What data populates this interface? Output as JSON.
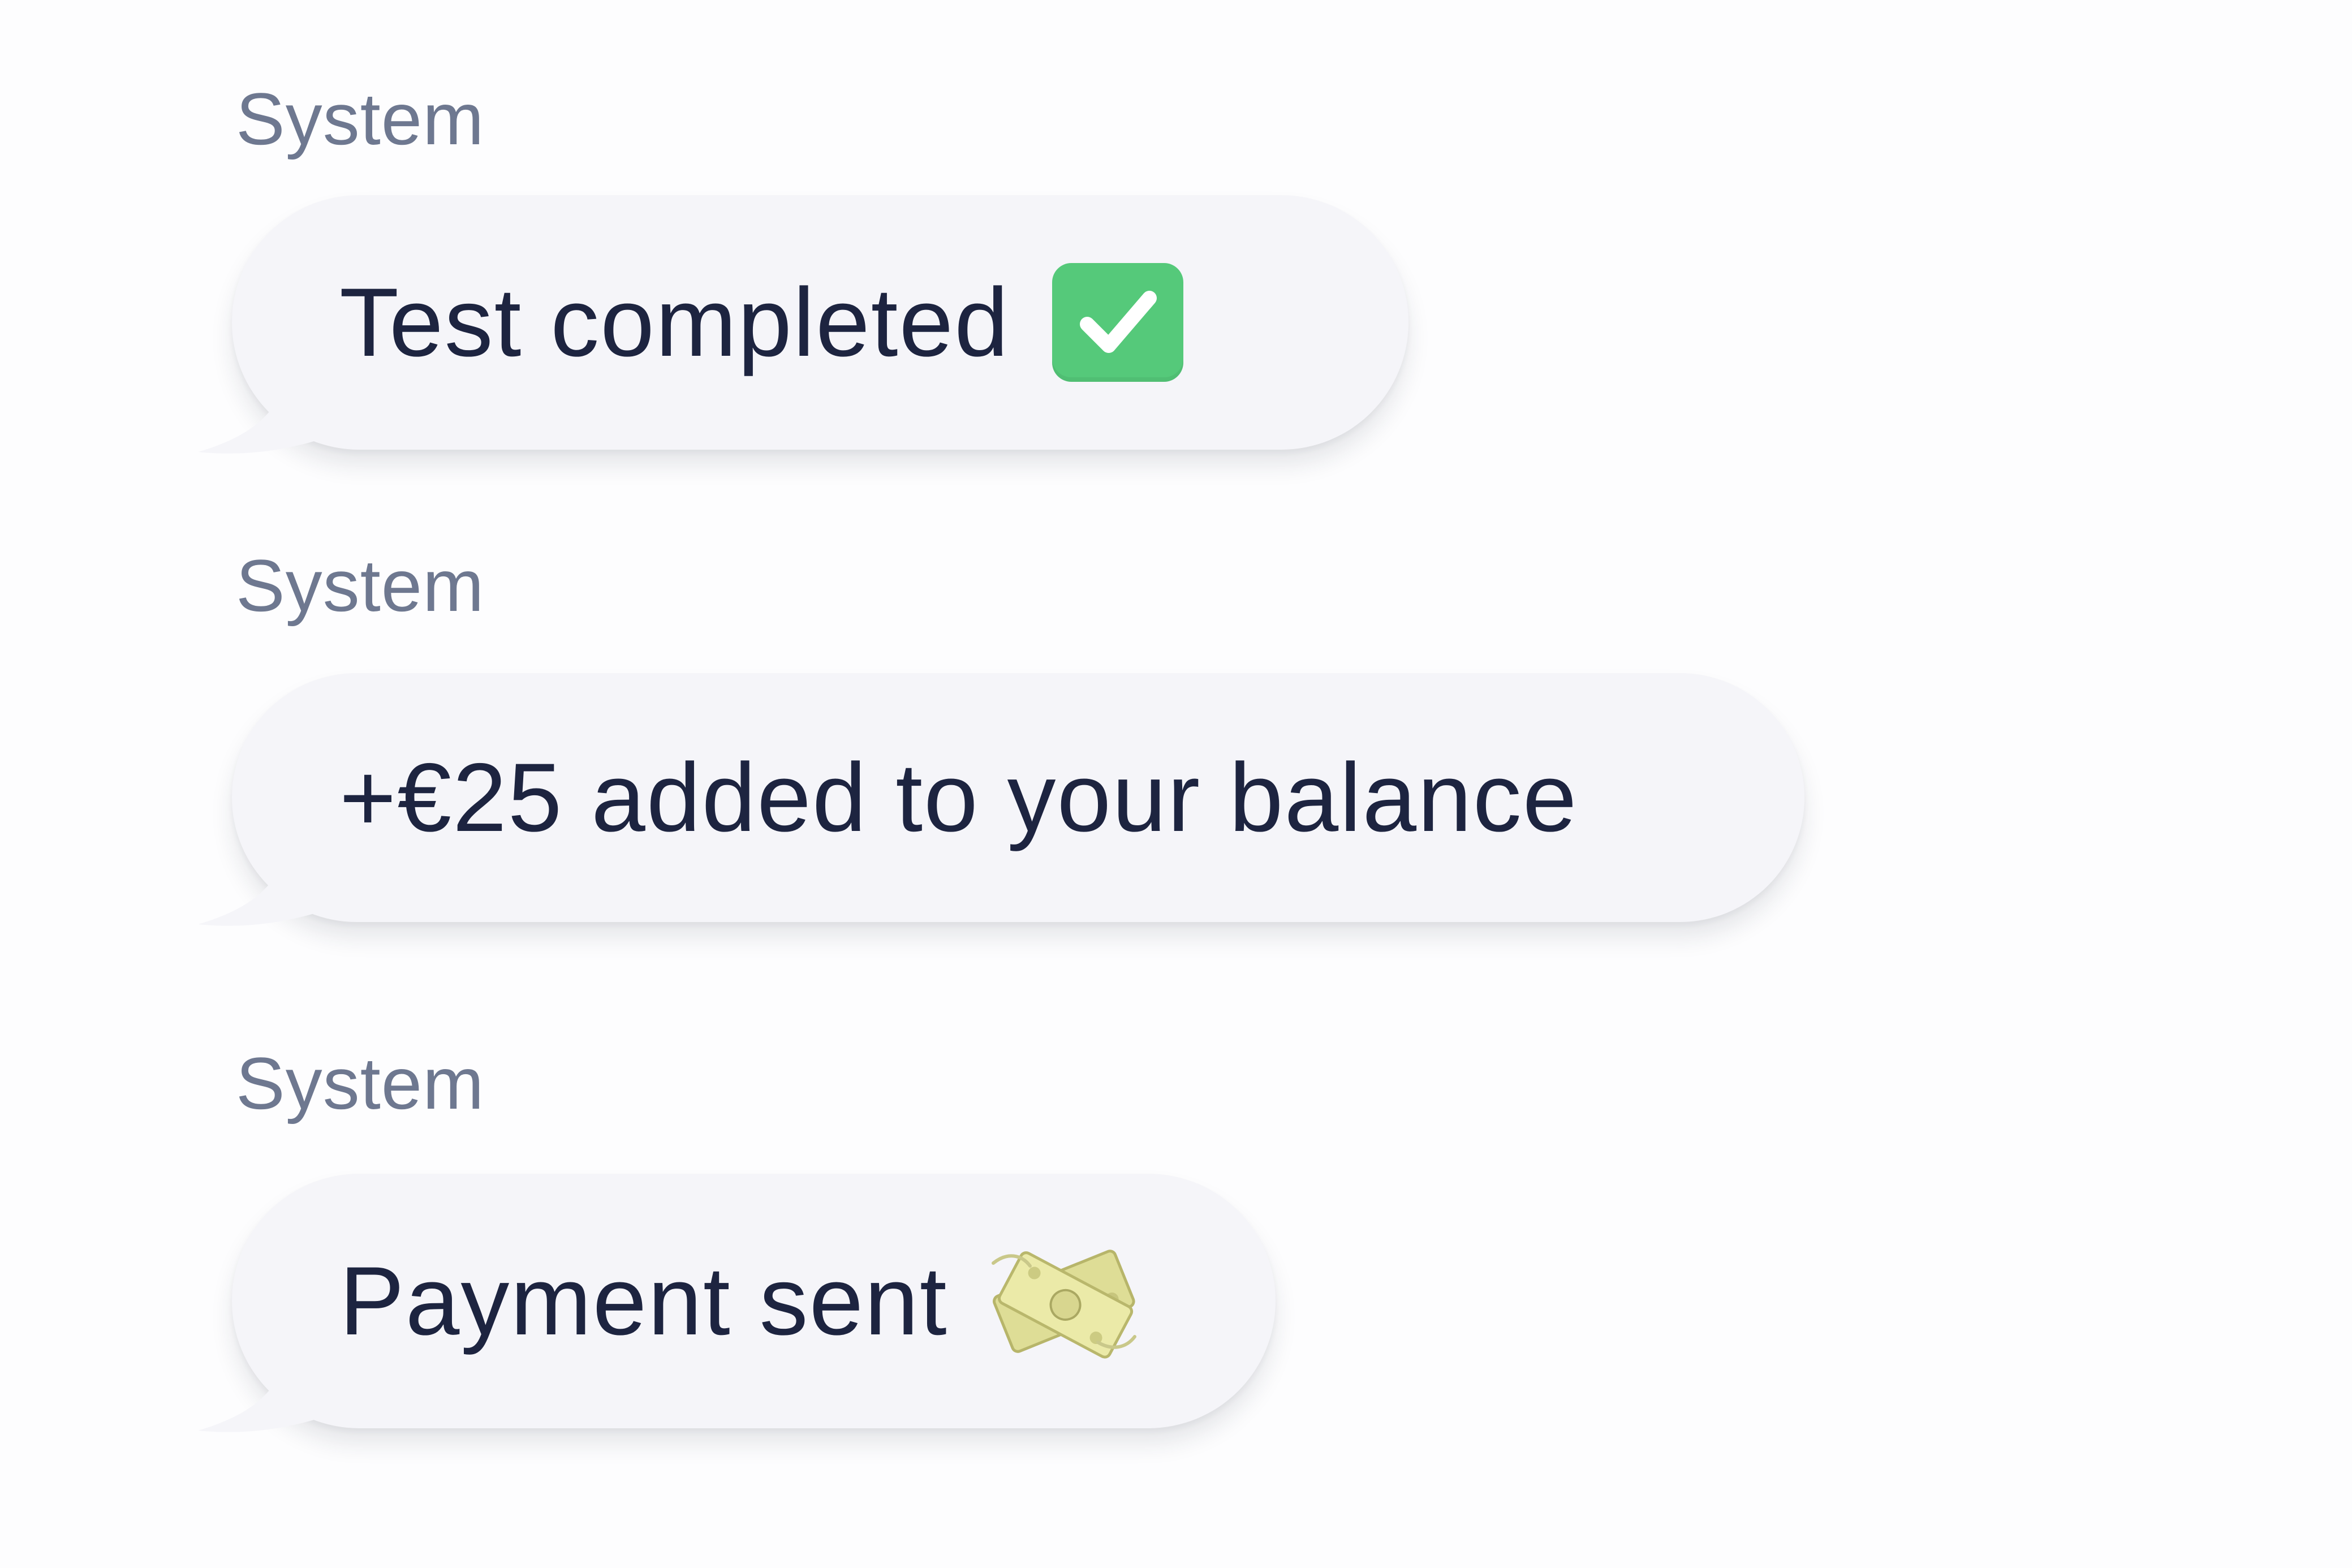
{
  "messages": [
    {
      "sender": "System",
      "text": "Test completed",
      "emoji": "check-mark-button-icon"
    },
    {
      "sender": "System",
      "text": "+€25 added to your balance",
      "emoji": ""
    },
    {
      "sender": "System",
      "text": "Payment sent",
      "emoji": "money-with-wings-icon"
    }
  ],
  "colors": {
    "background": "#fdfdfe",
    "bubble": "#f5f5f9",
    "sender_text": "#6e7890",
    "message_text": "#1d2440",
    "check_green": "#55c97a",
    "money_yellow": "#e8e6a4"
  }
}
